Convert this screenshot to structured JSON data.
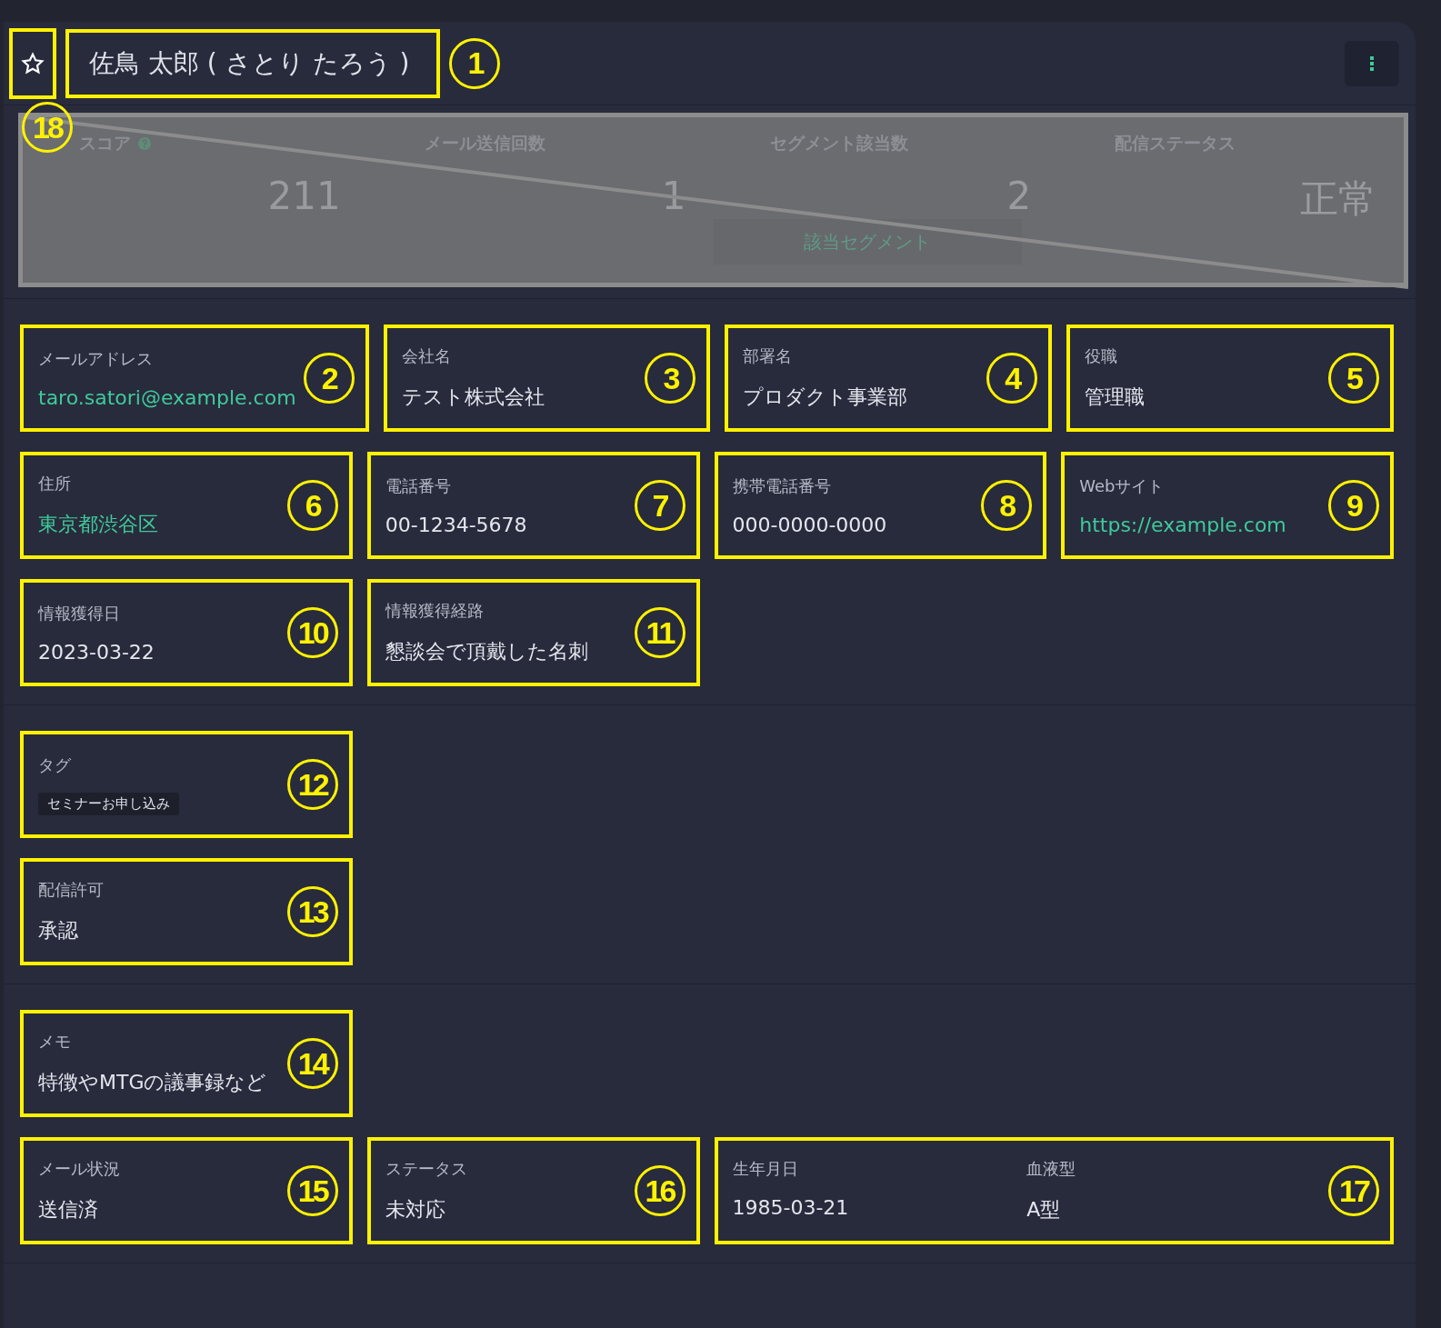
{
  "header": {
    "name": "佐鳥 太郎 ( さとり たろう )",
    "marker": "1"
  },
  "stats": {
    "marker": "18",
    "items": [
      {
        "label": "スコア",
        "value": "211",
        "help": true
      },
      {
        "label": "メール送信回数",
        "value": "1",
        "help": false
      },
      {
        "label": "セグメント該当数",
        "value": "2",
        "help": false,
        "button": "該当セグメント"
      },
      {
        "label": "配信ステータス",
        "value": "正常",
        "help": false
      }
    ]
  },
  "groups": [
    {
      "rows": [
        [
          {
            "kind": "link",
            "label": "メールアドレス",
            "value": "taro.satori@example.com",
            "marker": "2"
          },
          {
            "kind": "text",
            "label": "会社名",
            "value": "テスト株式会社",
            "marker": "3"
          },
          {
            "kind": "text",
            "label": "部署名",
            "value": "プロダクト事業部",
            "marker": "4"
          },
          {
            "kind": "text",
            "label": "役職",
            "value": "管理職",
            "marker": "5"
          }
        ],
        [
          {
            "kind": "link",
            "label": "住所",
            "value": "東京都渋谷区",
            "marker": "6"
          },
          {
            "kind": "text",
            "label": "電話番号",
            "value": "00-1234-5678",
            "marker": "7"
          },
          {
            "kind": "text",
            "label": "携帯電話番号",
            "value": "000-0000-0000",
            "marker": "8"
          },
          {
            "kind": "link",
            "label": "Webサイト",
            "value": "https://example.com",
            "marker": "9"
          }
        ],
        [
          {
            "kind": "text",
            "label": "情報獲得日",
            "value": "2023-03-22",
            "marker": "10"
          },
          {
            "kind": "text",
            "label": "情報獲得経路",
            "value": "懇談会で頂戴した名刺",
            "marker": "11"
          }
        ]
      ]
    },
    {
      "rows": [
        [
          {
            "kind": "tag",
            "label": "タグ",
            "value": "セミナーお申し込み",
            "marker": "12"
          }
        ],
        [
          {
            "kind": "text",
            "label": "配信許可",
            "value": "承認",
            "marker": "13"
          }
        ]
      ]
    },
    {
      "rows": [
        [
          {
            "kind": "text",
            "label": "メモ",
            "value": "特徴やMTGの議事録など",
            "marker": "14"
          }
        ],
        [
          {
            "kind": "text",
            "label": "メール状況",
            "value": "送信済",
            "marker": "15"
          },
          {
            "kind": "text",
            "label": "ステータス",
            "value": "未対応",
            "marker": "16"
          },
          {
            "kind": "pair",
            "marker": "17",
            "items": [
              {
                "label": "生年月日",
                "value": "1985-03-21"
              },
              {
                "label": "血液型",
                "value": "A型"
              }
            ]
          }
        ]
      ]
    }
  ]
}
